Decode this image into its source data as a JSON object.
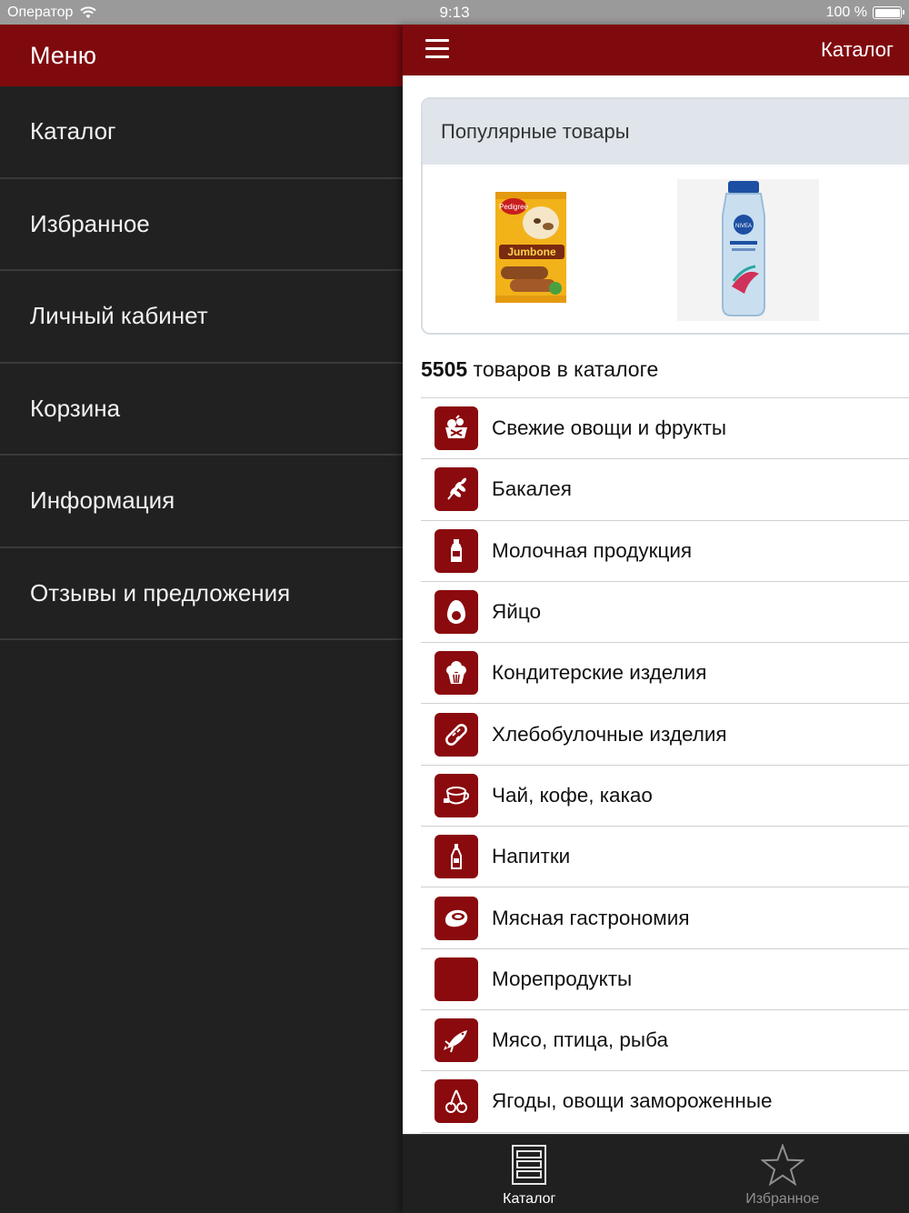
{
  "status_bar": {
    "carrier": "Оператор",
    "time": "9:13",
    "battery": "100 %"
  },
  "sidebar": {
    "title": "Меню",
    "items": [
      {
        "label": "Каталог"
      },
      {
        "label": "Избранное"
      },
      {
        "label": "Личный кабинет"
      },
      {
        "label": "Корзина"
      },
      {
        "label": "Информация"
      },
      {
        "label": "Отзывы и предложения"
      }
    ]
  },
  "navbar": {
    "title": "Каталог",
    "menu_icon": "hamburger-icon"
  },
  "popular": {
    "title": "Популярные товары",
    "products": [
      {
        "name": "Pedigree Jumbone",
        "brand": "Pedigree",
        "text": "Jumbone"
      },
      {
        "name": "Nivea shampoo",
        "brand": "NIVEA"
      }
    ]
  },
  "catalog": {
    "count": "5505",
    "count_suffix": " товаров в каталоге",
    "categories": [
      {
        "label": "Свежие овощи и фрукты",
        "icon": "fruit-basket-icon"
      },
      {
        "label": "Бакалея",
        "icon": "wheat-icon"
      },
      {
        "label": "Молочная продукция",
        "icon": "milk-bottle-icon"
      },
      {
        "label": "Яйцо",
        "icon": "egg-icon"
      },
      {
        "label": "Кондитерские изделия",
        "icon": "cupcake-icon"
      },
      {
        "label": "Хлебобулочные изделия",
        "icon": "bread-icon"
      },
      {
        "label": "Чай, кофе, какао",
        "icon": "teacup-icon"
      },
      {
        "label": "Напитки",
        "icon": "bottle-icon"
      },
      {
        "label": "Мясная гастрономия",
        "icon": "ham-icon"
      },
      {
        "label": "Морепродукты",
        "icon": "seafood-icon"
      },
      {
        "label": "Мясо, птица, рыба",
        "icon": "fish-icon"
      },
      {
        "label": "Ягоды, овощи замороженные",
        "icon": "cherries-icon"
      }
    ]
  },
  "tabs": [
    {
      "label": "Каталог",
      "icon": "catalog-icon",
      "active": true
    },
    {
      "label": "Избранное",
      "icon": "star-icon",
      "active": false
    }
  ],
  "colors": {
    "brand": "#7f0a0e",
    "sidebar_bg": "#212121",
    "tab_bar_bg": "#202020"
  }
}
